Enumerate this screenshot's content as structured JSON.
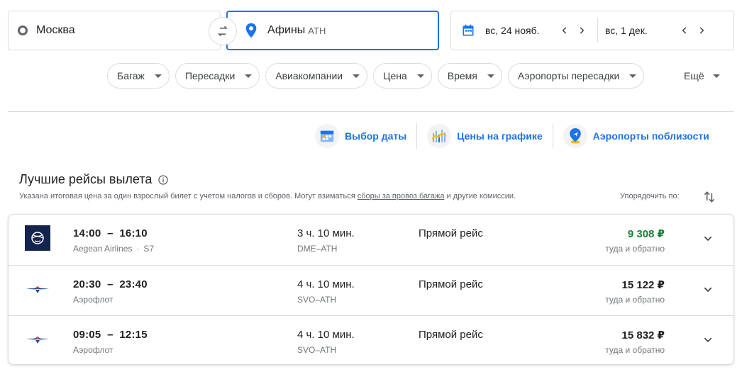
{
  "search": {
    "origin": "Москва",
    "destination": "Афины",
    "destination_code": "ATH",
    "depart_date": "вс, 24 нояб.",
    "return_date": "вс, 1 дек."
  },
  "filters": [
    "Багаж",
    "Пересадки",
    "Авиакомпании",
    "Цена",
    "Время",
    "Аэропорты пересадки"
  ],
  "more_label": "Ещё",
  "tools": {
    "date_grid": "Выбор даты",
    "price_graph": "Цены на графике",
    "nearby_airports": "Аэропорты поблизости"
  },
  "results": {
    "heading": "Лучшие рейсы вылета",
    "note_before": "Указана итоговая цена за один взрослый билет с учетом налогов и сборов. Могут взиматься ",
    "note_link": "сборы за провоз багажа",
    "note_after": " и другие комиссии.",
    "sort_label": "Упорядочить по:",
    "flights": [
      {
        "depart": "14:00",
        "arrive": "16:10",
        "airline": "Aegean Airlines",
        "partner": "S7",
        "duration": "3 ч. 10 мин.",
        "route": "DME–ATH",
        "stops": "Прямой рейс",
        "price": "9 308 ₽",
        "price_note": "туда и обратно",
        "logo": "aegean-logo"
      },
      {
        "depart": "20:30",
        "arrive": "23:40",
        "airline": "Аэрофлот",
        "partner": "",
        "duration": "4 ч. 10 мин.",
        "route": "SVO–ATH",
        "stops": "Прямой рейс",
        "price": "15 122 ₽",
        "price_note": "туда и обратно",
        "logo": "aeroflot-logo"
      },
      {
        "depart": "09:05",
        "arrive": "12:15",
        "airline": "Аэрофлот",
        "partner": "",
        "duration": "4 ч. 10 мин.",
        "route": "SVO–ATH",
        "stops": "Прямой рейс",
        "price": "15 832 ₽",
        "price_note": "туда и обратно",
        "logo": "aeroflot-logo"
      }
    ]
  },
  "colors": {
    "accent": "#1a73e8",
    "cheapest_price": "#188038",
    "aegean_navy": "#13254f",
    "aeroflot_blue": "#1a4f9c"
  }
}
